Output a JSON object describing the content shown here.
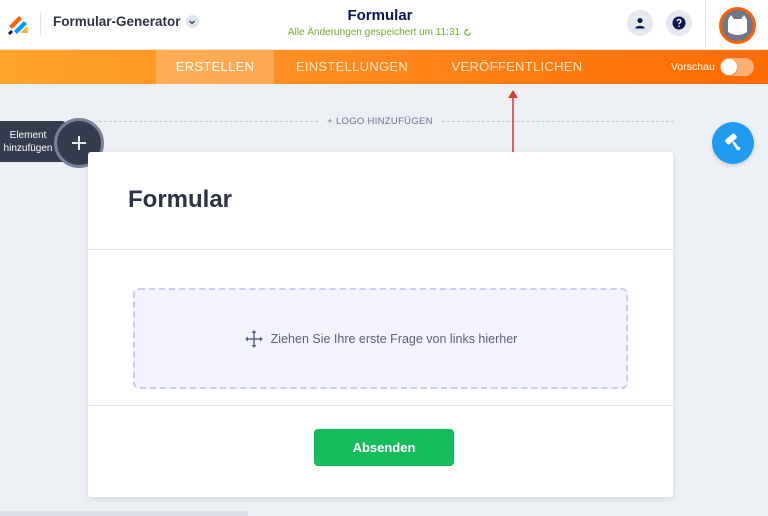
{
  "header": {
    "app_title": "Formular-Generator",
    "form_title": "Formular",
    "save_status": "Alle Änderungen gespeichert um 11:31"
  },
  "tabs": [
    {
      "label": "ERSTELLEN",
      "active": true
    },
    {
      "label": "EINSTELLUNGEN",
      "active": false
    },
    {
      "label": "VERÖFFENTLICHEN",
      "active": false
    }
  ],
  "preview": {
    "label": "Vorschau",
    "enabled": false
  },
  "canvas": {
    "add_logo_label": "+ LOGO HINZUFÜGEN",
    "add_element_label": "Element hinzufügen",
    "form_heading": "Formular",
    "dropzone_text": "Ziehen Sie Ihre erste Frage von links hierher",
    "submit_label": "Absenden"
  },
  "colors": {
    "accent_orange": "#ff6b00",
    "submit_green": "#18bd5b",
    "designer_blue": "#1f9cf0",
    "save_green": "#6dae2f",
    "annotation_red": "#e53935"
  },
  "icons": {
    "app_logo": "jotform-logo-icon",
    "user": "user-icon",
    "help": "help-icon",
    "add": "plus-icon",
    "designer": "paint-roller-icon",
    "move": "move-arrows-icon",
    "refresh": "refresh-icon"
  }
}
